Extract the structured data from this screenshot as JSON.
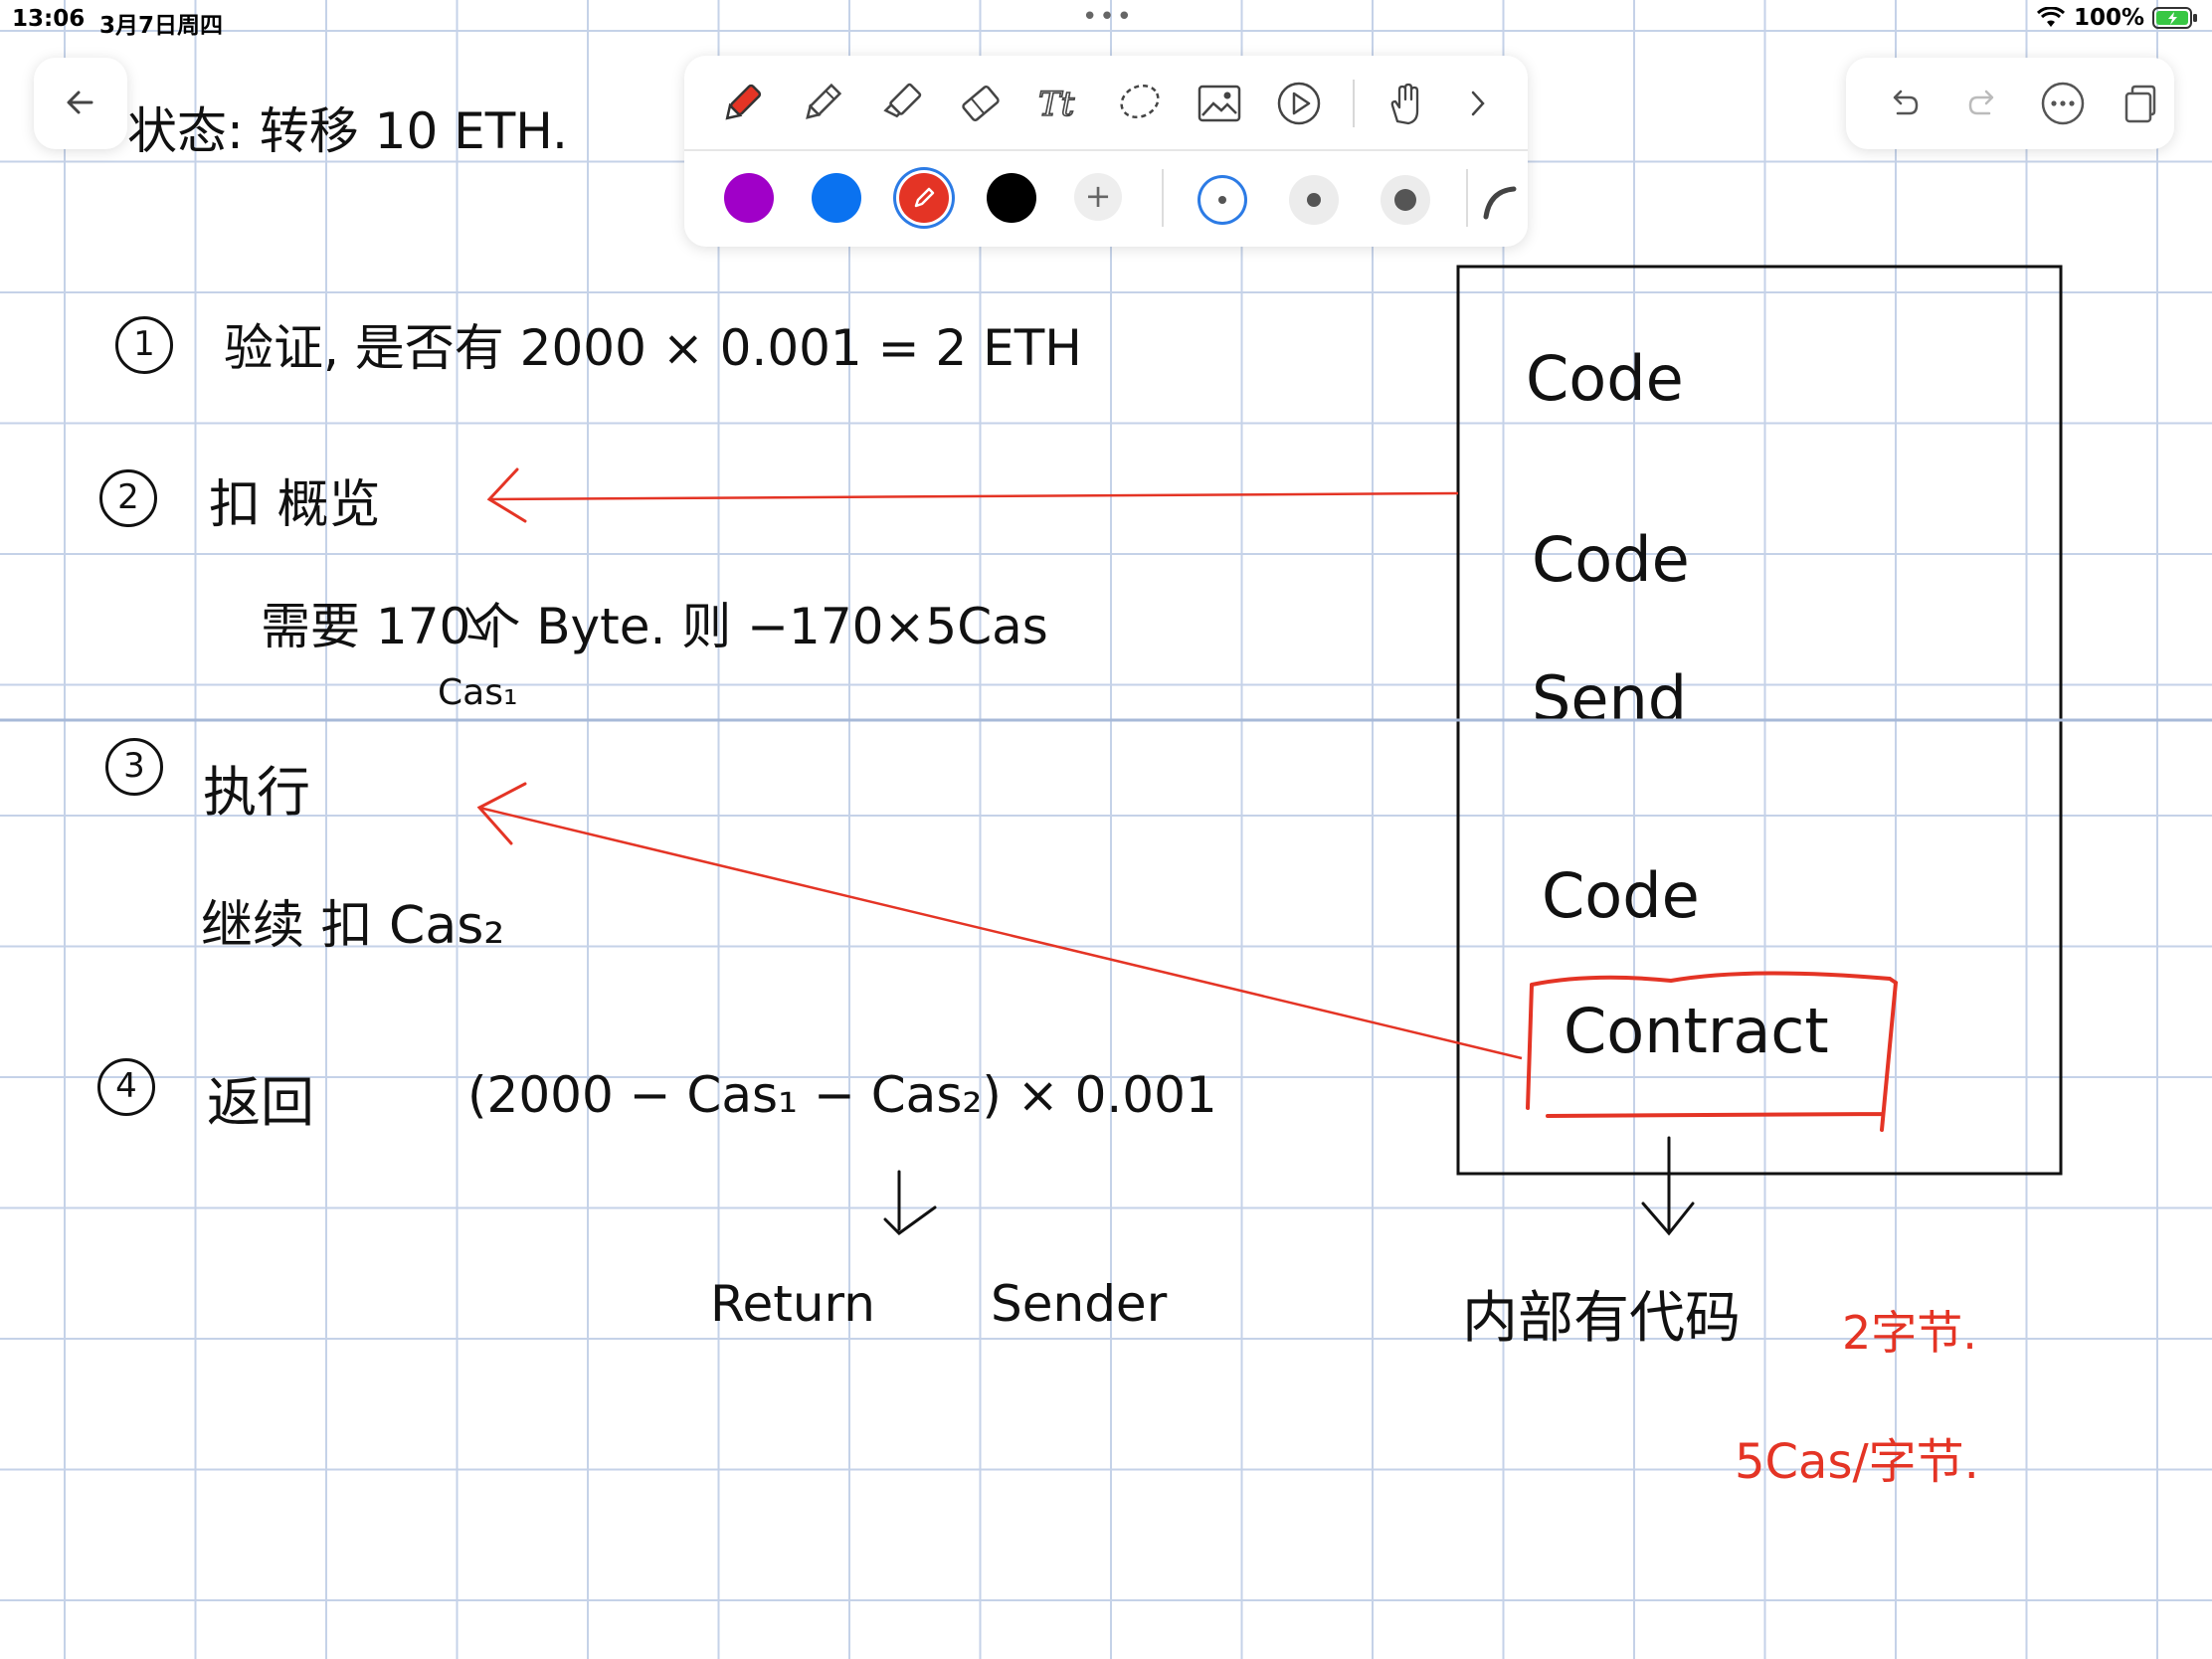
{
  "status_bar": {
    "time": "13:06",
    "date": "3月7日周四",
    "dots": "•••",
    "battery": "100%"
  },
  "toolbar": {
    "tools": [
      "pen-icon",
      "pencil-icon",
      "highlighter-icon",
      "eraser-icon",
      "text-tool-icon",
      "lasso-icon",
      "image-icon",
      "play-icon",
      "hand-icon",
      "chevron-right-icon"
    ],
    "colors": [
      "#a000c8",
      "#0a72f0",
      "#e43425",
      "#000000"
    ],
    "selected_color": "#e43425",
    "add_color_label": "+"
  },
  "top_right": {
    "buttons": [
      "undo-icon",
      "redo-icon",
      "more-icon",
      "pages-icon"
    ]
  },
  "note": {
    "title": "状态: 转移 10 ETH.",
    "step1_num": "1",
    "step1_text": "验证, 是否有 2000 × 0.001 = 2 ETH",
    "step2_num": "2",
    "step2_text": "扣 概览",
    "step2_sub": "需要 170个 Byte. 则 −170×5Cas",
    "step2_sub_note": "Cas₁",
    "step3_num": "3",
    "step3_text": "执行",
    "step3_sub": "继续 扣 Cas₂",
    "step4_num": "4",
    "step4_text": "返回",
    "step4_formula": "(2000 − Cas₁ − Cas₂) × 0.001",
    "step4_return": "Return",
    "step4_sender": "Sender",
    "box_items": [
      "Code",
      "Code",
      "Send",
      "Code"
    ],
    "box_contract": "Contract",
    "box_below": "内部有代码",
    "red_note1": "2字节.",
    "red_note2": "5Cas/字节."
  }
}
